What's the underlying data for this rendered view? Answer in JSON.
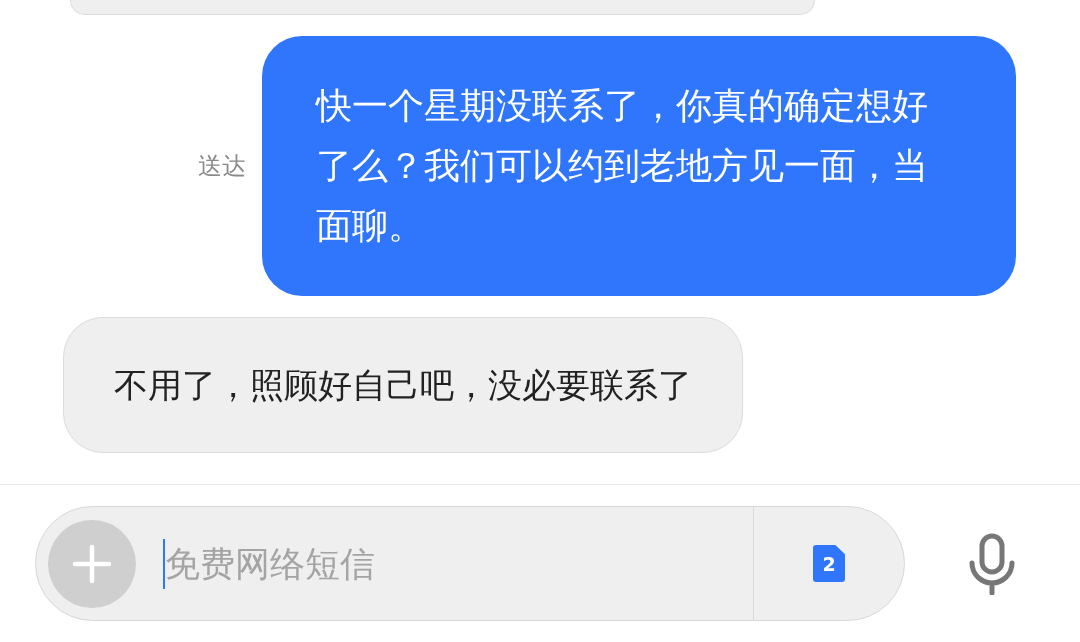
{
  "messages": [
    {
      "kind": "received_partial"
    },
    {
      "kind": "sent",
      "status": "送达",
      "text": "快一个星期没联系了，你真的确定想好了么？我们可以约到老地方见一面，当面聊。"
    },
    {
      "kind": "received",
      "text": "不用了，照顾好自己吧，没必要联系了"
    }
  ],
  "composer": {
    "placeholder": "免费网络短信",
    "sim_slot": "2"
  }
}
